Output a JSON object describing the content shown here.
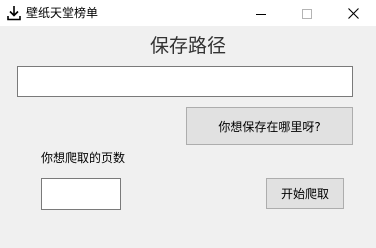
{
  "window": {
    "title": "壁纸天堂榜单",
    "icon": "download-icon",
    "controls": [
      "minimize-icon",
      "maximize-icon",
      "close-icon"
    ]
  },
  "main": {
    "heading": "保存路径",
    "path_input": {
      "value": "",
      "placeholder": ""
    },
    "choose_location_button": "你想保存在哪里呀?",
    "pages_label": "你想爬取的页数",
    "pages_input": {
      "value": "",
      "placeholder": ""
    },
    "start_button": "开始爬取"
  }
}
